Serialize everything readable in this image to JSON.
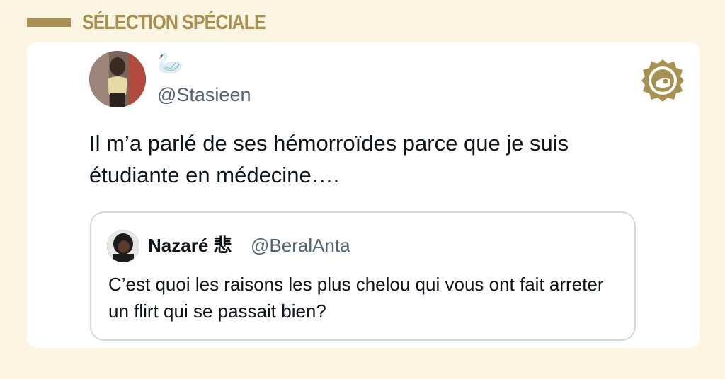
{
  "header": {
    "label": "SÉLECTION SPÉCIALE",
    "accent_color": "#a79050"
  },
  "tweet": {
    "display_name": "🦢",
    "handle": "@Stasieen",
    "text": "Il m’a parlé de ses hémorroïdes parce que je suis étudiante en médecine….",
    "avatar_icon": "user-avatar"
  },
  "quoted_tweet": {
    "display_name": "Nazaré 悲",
    "handle": "@BeralAnta",
    "text": "C’est quoi les raisons les plus chelou qui vous ont fait arreter un flirt qui se passait bien?",
    "avatar_icon": "user-avatar"
  },
  "brand": {
    "icon": "brand-logo-icon"
  },
  "colors": {
    "background": "#fbf5e1",
    "card": "#ffffff",
    "secondary_text": "#536471",
    "quote_border": "#cfd9de"
  }
}
